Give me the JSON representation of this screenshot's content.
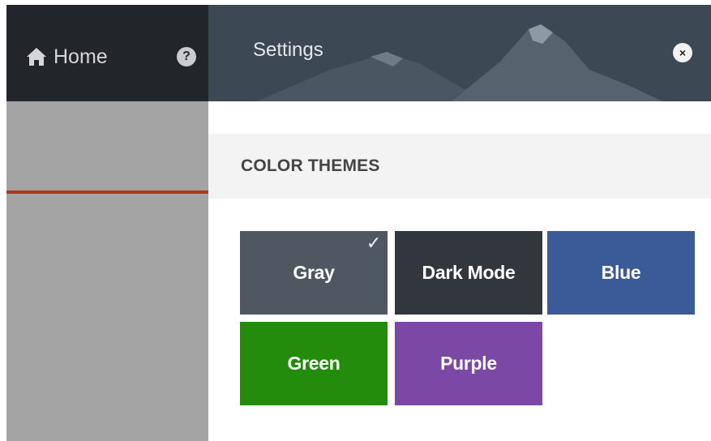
{
  "nav": {
    "home_label": "Home",
    "help_icon": "?"
  },
  "settings": {
    "title": "Settings",
    "close_icon": "×",
    "section_title": "COLOR THEMES",
    "themes": [
      {
        "label": "Gray",
        "color": "#4f5862",
        "selected": true,
        "check": "✓"
      },
      {
        "label": "Dark Mode",
        "color": "#32363d",
        "selected": false
      },
      {
        "label": "Blue",
        "color": "#3b5a98",
        "selected": false
      },
      {
        "label": "Green",
        "color": "#238c0c",
        "selected": false
      },
      {
        "label": "Purple",
        "color": "#7c48a6",
        "selected": false
      }
    ]
  },
  "colors": {
    "topbar": "#22262b",
    "sidebar_bg": "#a4a4a4",
    "active_line": "#b2361c",
    "header_bg": "#3c4853"
  }
}
